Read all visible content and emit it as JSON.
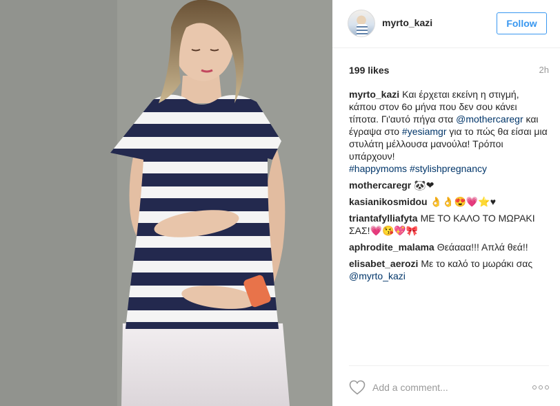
{
  "post": {
    "photo_alt": "",
    "header": {
      "username": "myrto_kazi",
      "follow_label": "Follow"
    },
    "likes": "199 likes",
    "time": "2h",
    "caption": {
      "user": "myrto_kazi",
      "text_1": "Και έρχεται εκείνη η στιγμή, κάπου στον 6ο μήνα που δεν σου κάνει τίποτα. Γι'αυτό πήγα στα ",
      "mention_1": "@mothercaregr",
      "text_2": " και έγραψα στο ",
      "tag_1": "#yesiamgr",
      "text_3": " για το πώς θα είσαι μια στυλάτη μέλλουσα μανούλα! Τρόποι υπάρχουν!",
      "tag_2": "#happymoms",
      "tag_3": "#stylishpregnancy"
    },
    "comments": [
      {
        "user": "mothercaregr",
        "text": "🐼❤"
      },
      {
        "user": "kasianikosmidou",
        "text": "👌👌😍💗⭐♥"
      },
      {
        "user": "triantafylliafyta",
        "text": "ΜΕ ΤΟ ΚΑΛΟ ΤΟ ΜΩΡΑΚΙ ΣΑΣ!💗😘💖🎀"
      },
      {
        "user": "aphrodite_malama",
        "text": "Θεάααα!!! Απλά θεά!!"
      },
      {
        "user": "elisabet_aerozi",
        "text": "Με το καλό το μωράκι σας",
        "mention": "@myrto_kazi"
      }
    ],
    "comment_placeholder": "Add a comment...",
    "icons": {
      "like": "heart-icon",
      "more": "more-options-icon"
    },
    "colors": {
      "link": "#003569",
      "follow": "#3897f0",
      "muted": "#999999"
    }
  }
}
